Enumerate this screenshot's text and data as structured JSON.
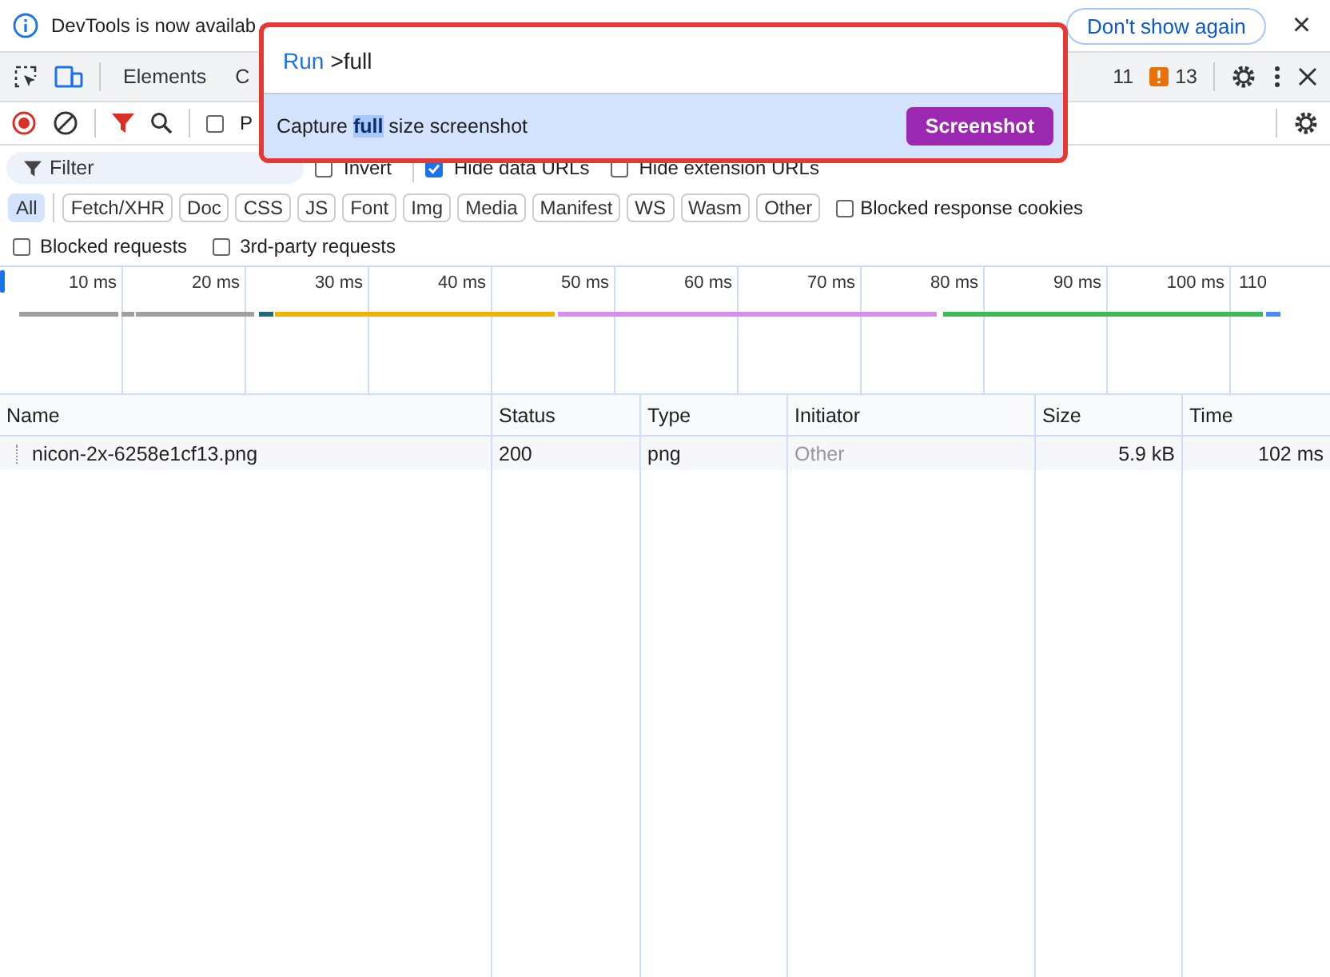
{
  "banner": {
    "message": "DevTools is now availab",
    "dismiss_label": "Don't show again",
    "close": "×"
  },
  "main_tabs": [
    {
      "label": "Elements",
      "selected": false
    },
    {
      "label": "C",
      "selected": false
    }
  ],
  "issues": {
    "warnings": "11",
    "errors": "13"
  },
  "network_toolbar": {
    "recording": true,
    "preserve_log": {
      "label": "P",
      "checked": false
    }
  },
  "filter": {
    "placeholder": "Filter",
    "options": [
      {
        "label": "Invert",
        "checked": false
      },
      {
        "label": "Hide data URLs",
        "checked": true
      },
      {
        "label": "Hide extension URLs",
        "checked": false
      }
    ]
  },
  "type_filters": [
    {
      "label": "All",
      "selected": true
    },
    {
      "label": "Fetch/XHR",
      "selected": false
    },
    {
      "label": "Doc",
      "selected": false
    },
    {
      "label": "CSS",
      "selected": false
    },
    {
      "label": "JS",
      "selected": false
    },
    {
      "label": "Font",
      "selected": false
    },
    {
      "label": "Img",
      "selected": false
    },
    {
      "label": "Media",
      "selected": false
    },
    {
      "label": "Manifest",
      "selected": false
    },
    {
      "label": "WS",
      "selected": false
    },
    {
      "label": "Wasm",
      "selected": false
    },
    {
      "label": "Other",
      "selected": false
    }
  ],
  "extra_filters": [
    {
      "label": "Blocked response cookies",
      "checked": false
    },
    {
      "label": "Blocked requests",
      "checked": false
    },
    {
      "label": "3rd-party requests",
      "checked": false
    }
  ],
  "timeline": {
    "ticks": [
      "10 ms",
      "20 ms",
      "30 ms",
      "40 ms",
      "50 ms",
      "60 ms",
      "70 ms",
      "80 ms",
      "90 ms",
      "100 ms",
      "110"
    ]
  },
  "table": {
    "columns": [
      "Name",
      "Status",
      "Type",
      "Initiator",
      "Size",
      "Time"
    ],
    "rows": [
      {
        "name": "nicon-2x-6258e1cf13.png",
        "status": "200",
        "type": "png",
        "initiator": "Other",
        "size": "5.9 kB",
        "time": "102 ms"
      }
    ]
  },
  "command_menu": {
    "prefix": "Run",
    "query": ">full",
    "results": [
      {
        "text": "Capture **full** size screenshot",
        "category": "Screenshot",
        "selected": true
      }
    ]
  }
}
